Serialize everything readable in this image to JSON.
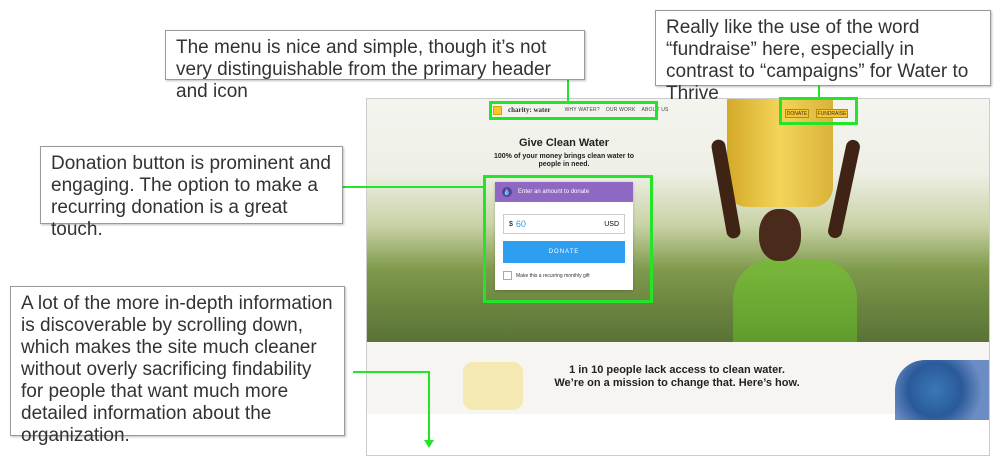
{
  "annotations": {
    "menu": "The menu is nice and simple, though it’s not very distinguishable from the primary header and icon",
    "fundraise": "Really like the use of the word “fundraise” here, especially in contrast to “campaigns” for Water to Thrive",
    "donation": "Donation button is prominent and engaging. The option to make a recurring donation is a great touch.",
    "scroll": "A lot of the more in-depth information is discoverable by scrolling down, which makes the site much cleaner without overly sacrificing findability for people that want much more detailed information about the organization."
  },
  "site": {
    "logo_text": "charity: water",
    "nav": [
      "WHY WATER?",
      "OUR WORK",
      "ABOUT US"
    ],
    "header_buttons": {
      "donate": "DONATE",
      "fundraise": "FUNDRAISE"
    },
    "hero": {
      "title": "Give Clean Water",
      "subtitle": "100% of your money brings clean water to people in need."
    },
    "donation_card": {
      "prompt": "Enter an amount to donate",
      "currency_symbol": "$",
      "amount": "60",
      "currency": "USD",
      "donate_label": "DONATE",
      "recurring_label": "Make this a recurring monthly gift"
    },
    "mission": {
      "line1": "1 in 10 people lack access to clean water.",
      "line2": "We’re on a mission to change that. Here’s how."
    }
  },
  "colors": {
    "highlight": "#22e52a",
    "card_header": "#8e68c2",
    "donate_button": "#2e9ff0",
    "brand_yellow": "#f7c62f"
  }
}
